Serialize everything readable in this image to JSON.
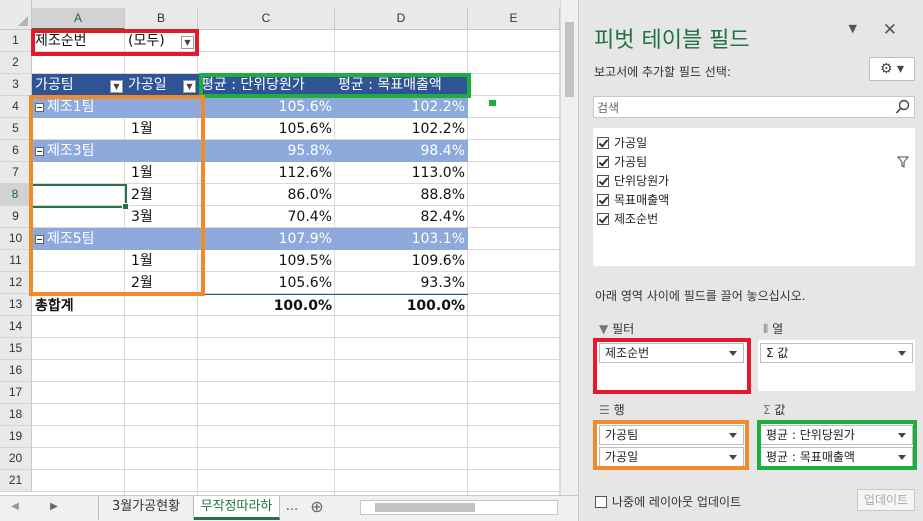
{
  "sheet": {
    "columns": [
      "A",
      "B",
      "C",
      "D",
      "E"
    ],
    "rows": [
      "1",
      "2",
      "3",
      "4",
      "5",
      "6",
      "7",
      "8",
      "9",
      "10",
      "11",
      "12",
      "13",
      "14",
      "15",
      "16",
      "17",
      "18",
      "19",
      "20",
      "21"
    ],
    "filter": {
      "label": "제조순번",
      "value": "(모두)"
    },
    "headers": {
      "row_label": "가공팀",
      "col_label": "가공일",
      "measure1": "평균 : 단위당원가",
      "measure2": "평균 : 목표매출액"
    },
    "pivot_rows": [
      {
        "a": "제조1팀",
        "b": "",
        "c": "105.6%",
        "d": "102.2%",
        "group": true
      },
      {
        "a": "",
        "b": "1월",
        "c": "105.6%",
        "d": "102.2%",
        "group": false
      },
      {
        "a": "제조3팀",
        "b": "",
        "c": "95.8%",
        "d": "98.4%",
        "group": true
      },
      {
        "a": "",
        "b": "1월",
        "c": "112.6%",
        "d": "113.0%",
        "group": false
      },
      {
        "a": "",
        "b": "2월",
        "c": "86.0%",
        "d": "88.8%",
        "group": false
      },
      {
        "a": "",
        "b": "3월",
        "c": "70.4%",
        "d": "82.4%",
        "group": false
      },
      {
        "a": "제조5팀",
        "b": "",
        "c": "107.9%",
        "d": "103.1%",
        "group": true
      },
      {
        "a": "",
        "b": "1월",
        "c": "109.5%",
        "d": "109.6%",
        "group": false
      },
      {
        "a": "",
        "b": "2월",
        "c": "105.6%",
        "d": "93.3%",
        "group": false
      }
    ],
    "total": {
      "label": "총합계",
      "c": "100.0%",
      "d": "100.0%"
    },
    "tabs": [
      {
        "label": "3월가공현황",
        "active": false
      },
      {
        "label": "무작정따라하",
        "active": true
      }
    ],
    "tab_more": "...",
    "tab_add": "⊕",
    "nav_prev": "◀",
    "nav_next": "▶"
  },
  "pane": {
    "title": "피벗 테이블 필드",
    "subtitle": "보고서에 추가할 필드 선택:",
    "search_placeholder": "검색",
    "fields": [
      {
        "label": "가공일",
        "checked": true
      },
      {
        "label": "가공팀",
        "checked": true
      },
      {
        "label": "단위당원가",
        "checked": true
      },
      {
        "label": "목표매출액",
        "checked": true
      },
      {
        "label": "제조순번",
        "checked": true
      }
    ],
    "drag_hint": "아래 영역 사이에 필드를 끌어 놓으십시오.",
    "areas": {
      "filter_label": "필터",
      "columns_label": "열",
      "rows_label": "행",
      "values_label": "값",
      "filter_items": [
        "제조순번"
      ],
      "column_items": [
        "Σ 값"
      ],
      "row_items": [
        "가공팀",
        "가공일"
      ],
      "value_items": [
        "평균 : 단위당원가",
        "평균 : 목표매출액"
      ]
    },
    "defer_label": "나중에 레이아웃 업데이트",
    "update_button": "업데이트"
  },
  "colors": {
    "accent": "#217346",
    "pivot_header": "#2f5496",
    "pivot_band": "#8ea9db",
    "red": "#e6192b",
    "orange": "#f08a2a",
    "green": "#1fae3d"
  }
}
